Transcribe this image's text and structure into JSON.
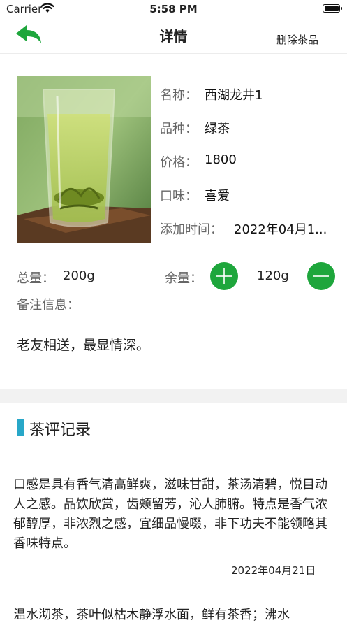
{
  "status_bar": {
    "carrier": "Carrier",
    "time": "5:58 PM"
  },
  "nav": {
    "title": "详情",
    "delete_label": "删除茶品",
    "accent": "#1ea63c"
  },
  "tea": {
    "name_label": "名称：",
    "name": "西湖龙井1",
    "variety_label": "品种：",
    "variety": "绿茶",
    "price_label": "价格：",
    "price": "1800",
    "taste_label": "口味：",
    "taste": "喜爱",
    "added_label": "添加时间：",
    "added": "2022年04月1..."
  },
  "stock": {
    "total_label": "总量：",
    "total": "200g",
    "remaining_label": "余量：",
    "remaining": "120g",
    "button_color": "#1ea63c"
  },
  "notes": {
    "label": "备注信息：",
    "text": "老友相送，最显情深。"
  },
  "reviews": {
    "title": "茶评记录",
    "marker_color": "#28a7c8",
    "items": [
      {
        "text": "口感是具有香气清高鲜爽，滋味甘甜，茶汤清碧，悦目动人之感。品饮欣赏，齿颊留芳，沁人肺腑。特点是香气浓郁醇厚，非浓烈之感，宜细品慢啜，非下功夫不能领略其香味特点。",
        "date": "2022年04月21日"
      },
      {
        "text": "温水沏茶，茶叶似枯木静浮水面，鲜有茶香；沸水"
      }
    ]
  }
}
